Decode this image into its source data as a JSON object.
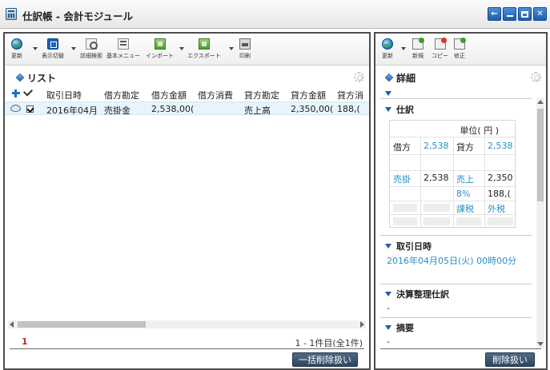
{
  "window": {
    "title": "仕訳帳 - 会計モジュール",
    "buttons": {
      "back": "←",
      "minimize": "",
      "maximize": "",
      "close": ""
    }
  },
  "left_panel": {
    "toolbar": [
      {
        "id": "refresh",
        "label": "更新",
        "icon": "globe-icon",
        "dropdown": true
      },
      {
        "id": "display",
        "label": "表示切替",
        "icon": "display-icon",
        "dropdown": true
      },
      {
        "id": "search",
        "label": "詳細検索",
        "icon": "search-icon",
        "dropdown": false
      },
      {
        "id": "menu",
        "label": "基本メニュー",
        "icon": "menu-icon",
        "dropdown": false
      },
      {
        "id": "import",
        "label": "インポート",
        "icon": "import-icon",
        "dropdown": true
      },
      {
        "id": "export",
        "label": "エクスポート",
        "icon": "export-icon",
        "dropdown": true
      },
      {
        "id": "print",
        "label": "印刷",
        "icon": "print-icon",
        "dropdown": false
      }
    ],
    "section_title": "リスト",
    "columns": [
      "取引日時",
      "借方勘定",
      "借方金額",
      "借方消費",
      "貸方勘定",
      "貸方金額",
      "貸方消"
    ],
    "rows": [
      {
        "date": "2016年04月",
        "debit_account": "売掛金",
        "debit_amount": "2,538,00(",
        "debit_tax": "",
        "credit_account": "売上高",
        "credit_amount": "2,350,00(",
        "credit_tax": "188,("
      }
    ],
    "pagination": {
      "page": "1",
      "info": "1 - 1件目(全1件)"
    },
    "bulk_delete_label": "一括削除扱い"
  },
  "right_panel": {
    "toolbar": [
      {
        "id": "refresh",
        "label": "更新",
        "icon": "globe-icon",
        "dropdown": true
      },
      {
        "id": "new",
        "label": "新規",
        "icon": "new-icon",
        "dropdown": false
      },
      {
        "id": "copy",
        "label": "コピー",
        "icon": "copy-icon",
        "dropdown": false
      },
      {
        "id": "edit",
        "label": "修正",
        "icon": "edit-icon",
        "dropdown": false
      }
    ],
    "section_title": "詳細",
    "journal": {
      "title": "仕訳",
      "unit": "単位( 円 )",
      "debit_label": "借方",
      "debit_total": "2,538",
      "credit_label": "貸方",
      "credit_total": "2,538",
      "debit_account": "売掛",
      "debit_amount": "2,538",
      "credit_account": "売上",
      "credit_amount": "2,350",
      "tax_rate": "8%",
      "tax_amount": "188,(",
      "tax_type": "課税",
      "tax_method": "外税"
    },
    "transaction_date": {
      "title": "取引日時",
      "value": "2016年04月05日(火) 00時00分"
    },
    "closing_entry": {
      "title": "決算整理仕訳",
      "value": "-"
    },
    "summary": {
      "title": "摘要",
      "value": "-"
    },
    "delete_label": "削除扱い"
  },
  "colors": {
    "accent_blue": "#2a8fc2",
    "header_dark": "#2c4660",
    "page_red": "#c62828"
  }
}
